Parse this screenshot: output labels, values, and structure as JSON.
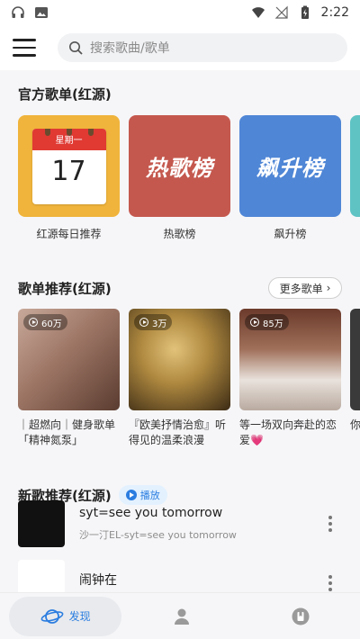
{
  "status_bar": {
    "time": "2:22"
  },
  "header": {
    "search_placeholder": "搜索歌曲/歌单"
  },
  "official": {
    "title": "官方歌单(红源)",
    "calendar": {
      "weekday": "星期一",
      "day": "17"
    },
    "items": [
      {
        "name": "红源每日推荐"
      },
      {
        "name": "热歌榜",
        "cover_text": "热歌榜"
      },
      {
        "name": "飙升榜",
        "cover_text": "飙升榜"
      }
    ]
  },
  "recommended": {
    "title": "歌单推荐(红源)",
    "more_label": "更多歌单",
    "items": [
      {
        "count": "60万",
        "title": "｜超燃向｜健身歌单「精神氮泵」"
      },
      {
        "count": "3万",
        "title": "『欧美抒情治愈』听得见的温柔浪漫"
      },
      {
        "count": "85万",
        "title": "等一场双向奔赴的恋爱💗"
      },
      {
        "count": "",
        "title": "你"
      }
    ]
  },
  "new_songs": {
    "title": "新歌推荐(红源)",
    "play_label": "播放",
    "songs": [
      {
        "name": "syt=see you tomorrow",
        "artist": "沙一汀EL-syt=see you tomorrow"
      },
      {
        "name": "闹钟在",
        "artist": ""
      }
    ]
  },
  "bottom_nav": {
    "discover_label": "发现"
  },
  "colors": {
    "accent": "#2b7de0",
    "background": "#f6f6f8"
  }
}
